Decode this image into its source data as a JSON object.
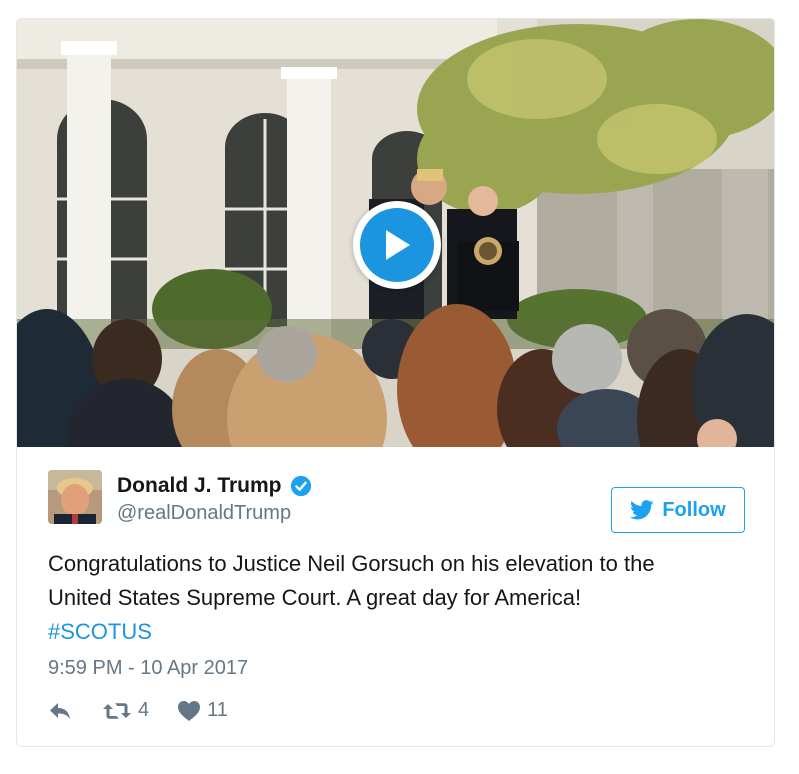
{
  "tweet": {
    "author_name": "Donald J. Trump",
    "handle": "@realDonaldTrump",
    "follow_label": "Follow",
    "text_line1": "Congratulations to Justice Neil Gorsuch on his elevation to the",
    "text_line2": "United States Supreme Court. A great day for America!",
    "hashtag": "#SCOTUS",
    "timestamp": "9:59 PM - 10 Apr 2017",
    "retweet_count": "4",
    "like_count": "11"
  },
  "icons": {
    "verified": "verified-badge-icon",
    "follow": "bird-icon",
    "reply": "reply-icon",
    "retweet": "retweet-icon",
    "like": "heart-icon",
    "play": "play-icon"
  },
  "colors": {
    "accent": "#1da1f2",
    "link": "#1b95e0",
    "muted": "#657786",
    "text": "#14171a",
    "border": "#e1e8ed"
  }
}
